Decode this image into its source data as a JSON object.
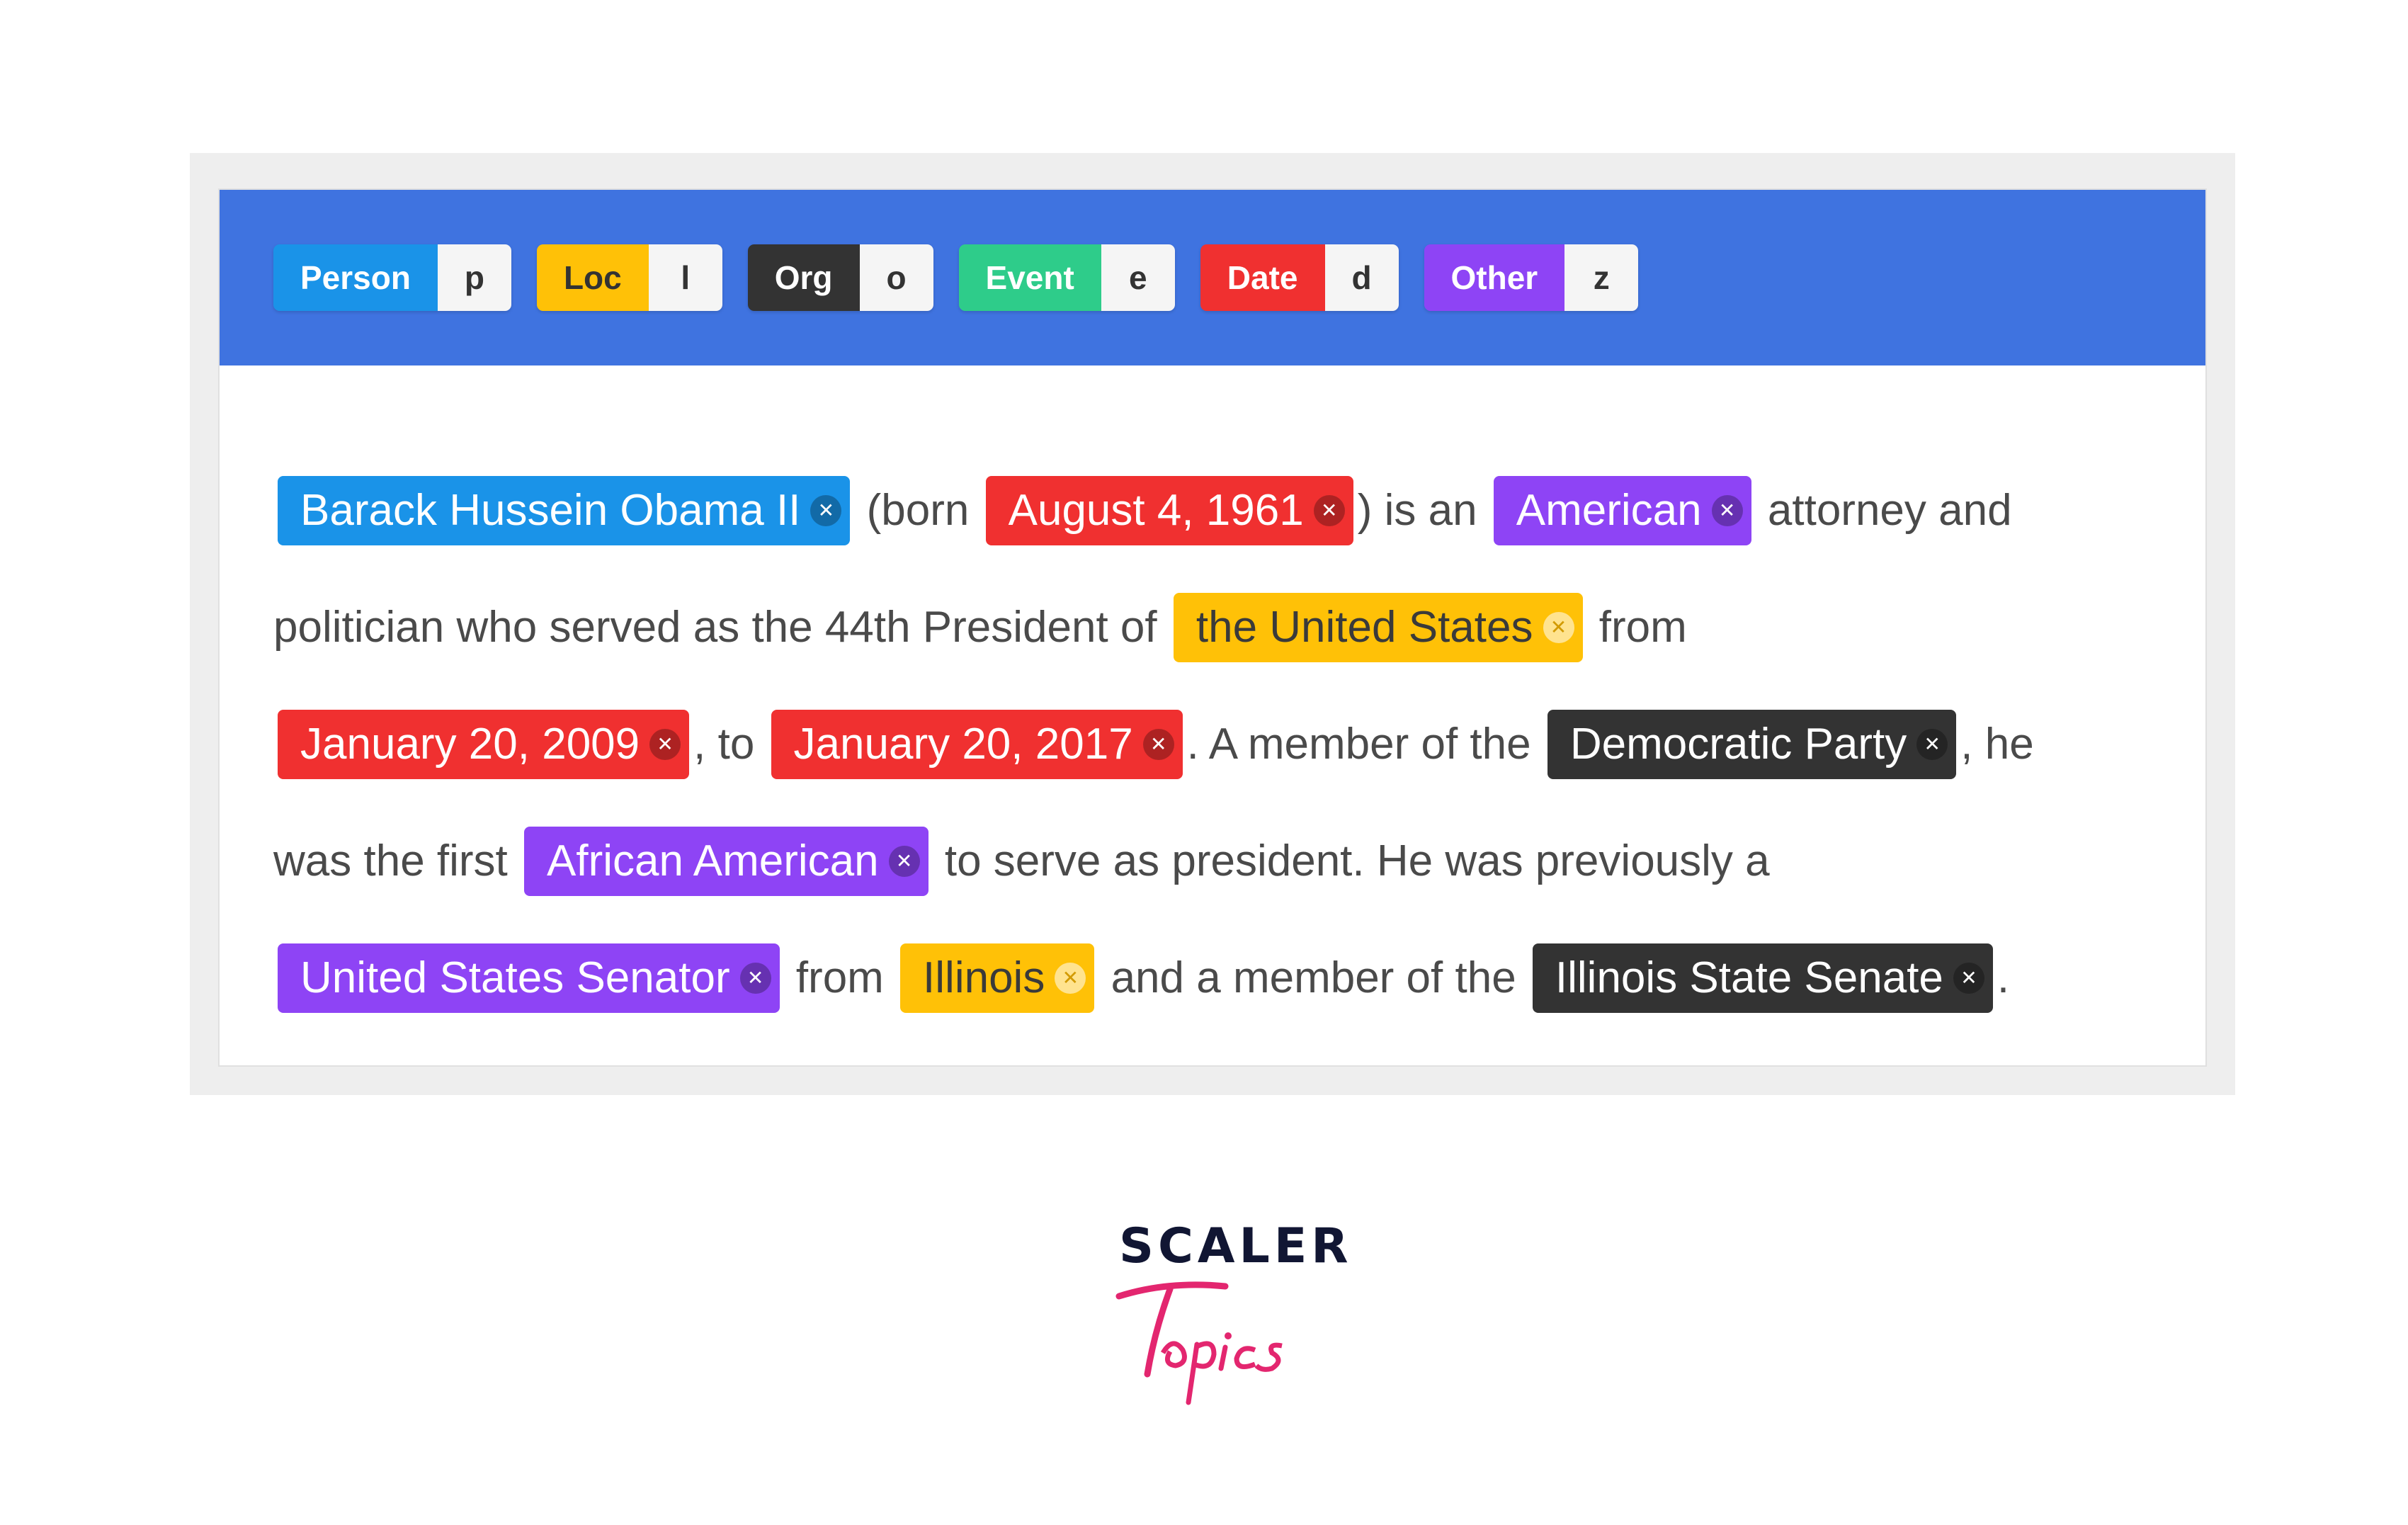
{
  "labels": [
    {
      "name": "Person",
      "key": "p",
      "color": "#1a93e8"
    },
    {
      "name": "Loc",
      "key": "l",
      "color": "#ffc107"
    },
    {
      "name": "Org",
      "key": "o",
      "color": "#333333"
    },
    {
      "name": "Event",
      "key": "e",
      "color": "#2ecc8a"
    },
    {
      "name": "Date",
      "key": "d",
      "color": "#f03030"
    },
    {
      "name": "Other",
      "key": "z",
      "color": "#8e44f5"
    }
  ],
  "lines": [
    [
      {
        "type": "entity",
        "text": "Barack Hussein Obama II",
        "label": "Person"
      },
      {
        "type": "text",
        "text": " (born "
      },
      {
        "type": "entity",
        "text": "August 4, 1961",
        "label": "Date"
      },
      {
        "type": "text",
        "text": ") is an "
      },
      {
        "type": "entity",
        "text": "American",
        "label": "Other"
      },
      {
        "type": "text",
        "text": " attorney and"
      }
    ],
    [
      {
        "type": "text",
        "text": "politician who served as the 44th President of "
      },
      {
        "type": "entity",
        "text": "the United States",
        "label": "Loc"
      },
      {
        "type": "text",
        "text": " from"
      }
    ],
    [
      {
        "type": "entity",
        "text": "January 20, 2009",
        "label": "Date"
      },
      {
        "type": "text",
        "text": ", to "
      },
      {
        "type": "entity",
        "text": "January 20, 2017",
        "label": "Date"
      },
      {
        "type": "text",
        "text": ". A member of the "
      },
      {
        "type": "entity",
        "text": "Democratic Party",
        "label": "Org"
      },
      {
        "type": "text",
        "text": ", he"
      }
    ],
    [
      {
        "type": "text",
        "text": "was the first "
      },
      {
        "type": "entity",
        "text": "African American",
        "label": "Other"
      },
      {
        "type": "text",
        "text": " to serve as president. He was previously a"
      }
    ],
    [
      {
        "type": "entity",
        "text": "United States Senator",
        "label": "Other"
      },
      {
        "type": "text",
        "text": " from "
      },
      {
        "type": "entity",
        "text": "Illinois",
        "label": "Loc"
      },
      {
        "type": "text",
        "text": " and a member of the "
      },
      {
        "type": "entity",
        "text": "Illinois State Senate",
        "label": "Org"
      },
      {
        "type": "text",
        "text": "."
      }
    ]
  ],
  "remove_icon": "close-icon",
  "brand": {
    "top": "SCALER",
    "bottom": "Topics",
    "top_color": "#111633",
    "bottom_color": "#e3266f"
  }
}
